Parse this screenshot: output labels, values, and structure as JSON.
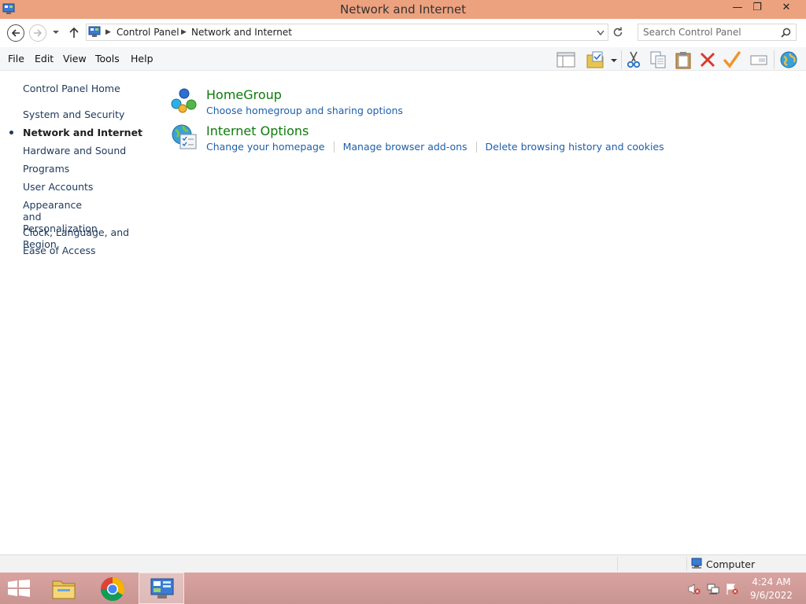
{
  "window": {
    "title": "Network and Internet",
    "minimize_label": "—",
    "restore_label": "❐",
    "close_label": "✕"
  },
  "address": {
    "crumbs": [
      "Control Panel",
      "Network and Internet"
    ],
    "search_placeholder": "Search Control Panel"
  },
  "menu": [
    "File",
    "Edit",
    "View",
    "Tools",
    "Help"
  ],
  "toolbar": {
    "icons": [
      "layout-icon",
      "properties-icon",
      "cut-icon",
      "copy-icon",
      "paste-icon",
      "delete-icon",
      "checkmark-icon",
      "rename-icon",
      "internet-icon"
    ]
  },
  "sidebar": {
    "home": "Control Panel Home",
    "items": [
      {
        "label": "System and Security",
        "current": false
      },
      {
        "label": "Network and Internet",
        "current": true
      },
      {
        "label": "Hardware and Sound",
        "current": false
      },
      {
        "label": "Programs",
        "current": false
      },
      {
        "label": "User Accounts",
        "current": false
      },
      {
        "label": "Appearance and Personalization",
        "current": false
      },
      {
        "label": "Clock, Language, and Region",
        "current": false
      },
      {
        "label": "Ease of Access",
        "current": false
      }
    ]
  },
  "categories": [
    {
      "title": "HomeGroup",
      "icon": "homegroup-icon",
      "links": [
        "Choose homegroup and sharing options"
      ]
    },
    {
      "title": "Internet Options",
      "icon": "internet-options-icon",
      "links": [
        "Change your homepage",
        "Manage browser add-ons",
        "Delete browsing history and cookies"
      ]
    }
  ],
  "statusbar": {
    "location": "Computer"
  },
  "taskbar": {
    "apps": [
      "file-explorer-icon",
      "chrome-icon",
      "control-panel-icon"
    ],
    "time": "4:24 AM",
    "date": "9/6/2022"
  },
  "colors": {
    "titlebar": "#eda27f",
    "link": "#1e5fa8",
    "category_title": "#0c7b0c",
    "taskbar": "#d8a3a0"
  }
}
